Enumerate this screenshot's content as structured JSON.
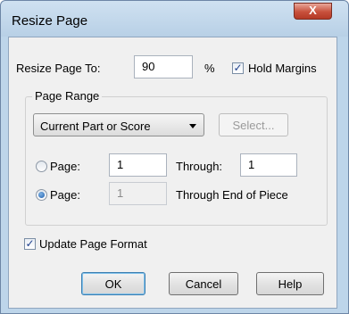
{
  "window": {
    "title": "Resize Page",
    "close_glyph": "X"
  },
  "resize": {
    "label": "Resize Page To:",
    "value": "90",
    "unit": "%",
    "hold_margins_label": "Hold Margins",
    "hold_margins_checked": true,
    "hold_margins_mark": "✓"
  },
  "page_range": {
    "title": "Page Range",
    "selected_option": "Current Part or Score",
    "select_button": "Select...",
    "row1": {
      "radio_label": "Page:",
      "selected": false,
      "from_value": "1",
      "through_label": "Through:",
      "through_value": "1"
    },
    "row2": {
      "radio_label": "Page:",
      "selected": true,
      "from_value": "1",
      "through_label": "Through End of Piece"
    }
  },
  "update_format": {
    "label": "Update Page Format",
    "checked": true,
    "mark": "✓"
  },
  "buttons": {
    "ok": "OK",
    "cancel": "Cancel",
    "help": "Help"
  }
}
